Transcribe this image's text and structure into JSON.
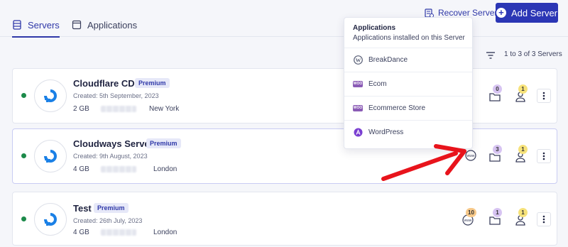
{
  "header": {
    "tabs": [
      {
        "label": "Servers",
        "icon": "server-icon",
        "active": true
      },
      {
        "label": "Applications",
        "icon": "window-icon",
        "active": false
      }
    ],
    "recover_label": "Recover Server",
    "add_label": "Add Server"
  },
  "list": {
    "count_text": "1 to 3 of 3 Servers"
  },
  "servers": [
    {
      "name": "Cloudflare CDN",
      "badge": "Premium",
      "created": "Created: 5th September, 2023",
      "size": "2 GB",
      "location": "New York",
      "apps_count": "",
      "folders_count": "0",
      "users_count": "1"
    },
    {
      "name": "Cloudways Server",
      "badge": "Premium",
      "created": "Created: 9th August, 2023",
      "size": "4 GB",
      "location": "London",
      "apps_count": "",
      "folders_count": "3",
      "users_count": "1"
    },
    {
      "name": "Test",
      "badge": "Premium",
      "created": "Created: 26th July, 2023",
      "size": "4 GB",
      "location": "London",
      "apps_count": "10",
      "folders_count": "1",
      "users_count": "1"
    }
  ],
  "popover": {
    "title": "Applications",
    "subtitle": "Applications installed on this Server",
    "items": [
      {
        "label": "BreakDance",
        "icon": "wordpress-icon"
      },
      {
        "label": "Ecom",
        "icon": "woocommerce-icon"
      },
      {
        "label": "Ecommerce Store",
        "icon": "woocommerce-icon"
      },
      {
        "label": "WordPress",
        "icon": "app-icon"
      }
    ],
    "woo_text": "WOO"
  },
  "colors": {
    "accent": "#2b36b5",
    "status_online": "#1c8a4a",
    "annotation_arrow": "#e8141c"
  }
}
